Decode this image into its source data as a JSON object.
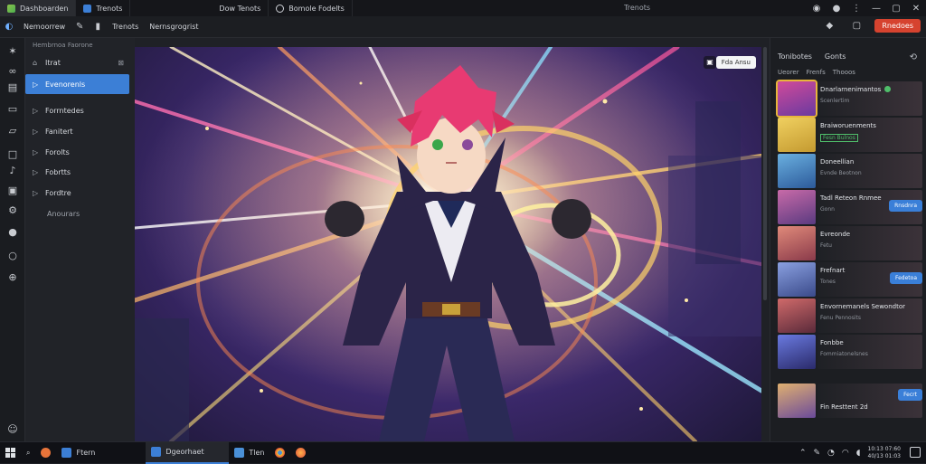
{
  "titlebar": {
    "tabs": [
      {
        "label": "Dashboarden",
        "icon": "app-logo-icon"
      },
      {
        "label": "Trenots",
        "icon": "document-icon"
      },
      {
        "label": "Dow Tenots",
        "icon": ""
      },
      {
        "label": "Bomole Fodelts",
        "icon": "github-icon"
      }
    ],
    "center_title": "Trenots",
    "controls": [
      "—",
      "▢",
      "✕"
    ]
  },
  "toolbar": {
    "items": [
      "Nemoorrew",
      "Trenots",
      "Nernsgrogrist"
    ],
    "share_label": "Rnedoes"
  },
  "sidebar": {
    "header": "Hembrnoa Faorone",
    "items": [
      {
        "label": "Itrat",
        "icon": "home-icon"
      },
      {
        "label": "Evenorenls",
        "icon": "chevron-right-icon"
      },
      {
        "label": "Forrntedes",
        "icon": "chevron-right-icon"
      },
      {
        "label": "Fanitert",
        "icon": "chevron-right-icon"
      },
      {
        "label": "Forolts",
        "icon": "chevron-right-icon"
      },
      {
        "label": "Fobrtts",
        "icon": "chevron-right-icon"
      },
      {
        "label": "Fordtre",
        "icon": "chevron-right-icon"
      },
      {
        "label": "Anourars",
        "icon": ""
      }
    ]
  },
  "canvas": {
    "chip_label": "Fda Ansu",
    "chip_icon": "image-icon"
  },
  "rpanel": {
    "tabs": [
      "Tonibotes",
      "Gonts"
    ],
    "subtabs": [
      "Ueorer",
      "Frenfs",
      "Thooos"
    ],
    "rows": [
      {
        "name": "Dnarlarnenimantos",
        "meta": "Scenlertim",
        "badge": "",
        "status": "online"
      },
      {
        "name": "Braiworuenments",
        "meta": "Fesn Bulnos",
        "badge": "",
        "status": ""
      },
      {
        "name": "Doneellian",
        "meta": "Evnde Beotnon",
        "badge": "",
        "status": ""
      },
      {
        "name": "Tadl Reteon Rnmee",
        "meta": "Gonn",
        "badge": "Rnsdnra",
        "status": ""
      },
      {
        "name": "Evreonde",
        "meta": "Fetu",
        "badge": "",
        "status": ""
      },
      {
        "name": "Frefnart",
        "meta": "Tones",
        "badge": "Fedetoa",
        "status": ""
      },
      {
        "name": "Envornemanels Sewondtor",
        "meta": "Fenu Pennosits",
        "badge": "",
        "status": ""
      },
      {
        "name": "Fonbbe",
        "meta": "Fommiatonelsnes",
        "badge": "",
        "status": ""
      },
      {
        "name": "Fin Resttent 2d",
        "meta": "",
        "badge": "Fecrt",
        "status": ""
      }
    ]
  },
  "taskbar": {
    "items": [
      "Ftern",
      "Dgeorhaet",
      "Tlen"
    ],
    "clock_time": "10:13 07:60",
    "clock_date": "40/13 01:03"
  },
  "colors": {
    "accent": "#3c7fd6",
    "share": "#d6432f",
    "online": "#4fbe6a"
  }
}
